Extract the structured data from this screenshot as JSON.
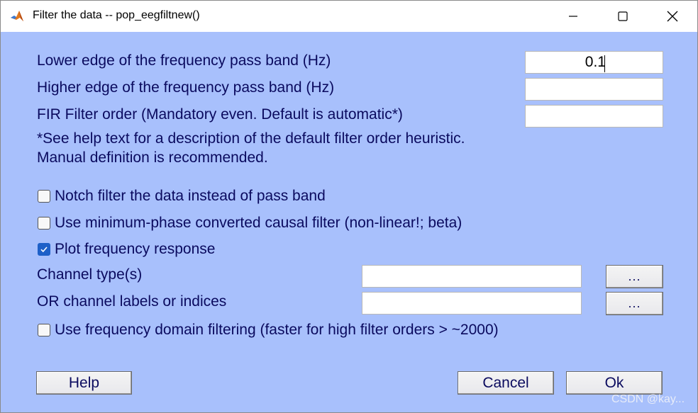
{
  "window": {
    "title": "Filter the data -- pop_eegfiltnew()"
  },
  "form": {
    "lower_edge_label": "Lower edge of the frequency pass band (Hz)",
    "lower_edge_value": "0.1",
    "higher_edge_label": "Higher edge of the frequency pass band (Hz)",
    "higher_edge_value": "",
    "filter_order_label": "FIR Filter order (Mandatory even. Default is automatic*)",
    "filter_order_value": "",
    "note_line1": "*See help text for a description of the default filter order heuristic.",
    "note_line2": "Manual definition is recommended.",
    "notch_label": "Notch filter the data instead of pass band",
    "notch_checked": false,
    "minphase_label": "Use minimum-phase converted causal filter (non-linear!; beta)",
    "minphase_checked": false,
    "plot_label": "Plot frequency response",
    "plot_checked": true,
    "channel_type_label": "Channel type(s)",
    "channel_type_value": "",
    "channel_type_browse": "...",
    "channel_labels_label": "OR channel labels or indices",
    "channel_labels_value": "",
    "channel_labels_browse": "...",
    "freqdomain_label": "Use frequency domain filtering (faster for high filter orders > ~2000)",
    "freqdomain_checked": false
  },
  "buttons": {
    "help": "Help",
    "cancel": "Cancel",
    "ok": "Ok"
  },
  "watermark": "CSDN @kay...",
  "colors": {
    "dialog_background": "#a8c0fc",
    "label_text": "#0a0a5e",
    "checkbox_checked": "#1e60c8"
  }
}
